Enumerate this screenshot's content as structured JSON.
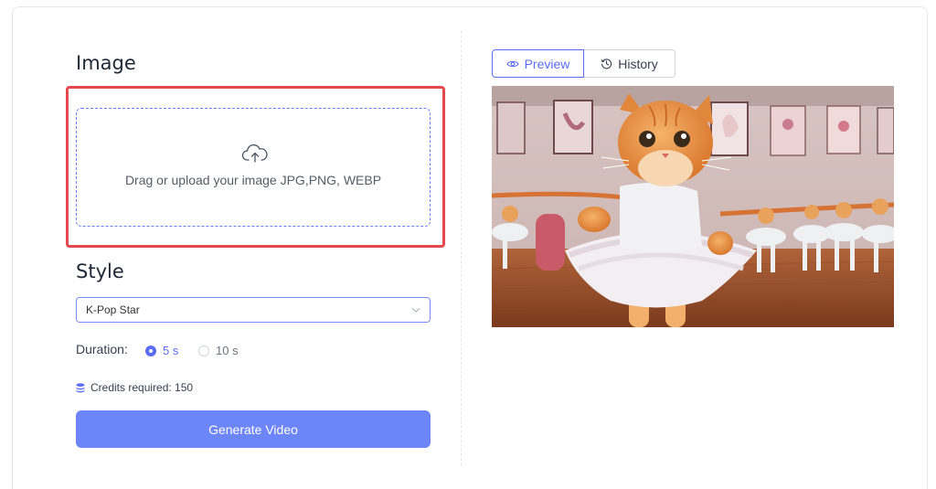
{
  "image_section": {
    "title": "Image",
    "upload_text": "Drag or upload your image JPG,PNG, WEBP"
  },
  "style_section": {
    "title": "Style",
    "selected_style": "K-Pop Star"
  },
  "duration": {
    "label": "Duration:",
    "options": [
      "5 s",
      "10 s"
    ],
    "selected": "5 s"
  },
  "credits": {
    "text": "Credits required: 150"
  },
  "generate_button": {
    "label": "Generate Video"
  },
  "tabs": {
    "preview": "Preview",
    "history": "History",
    "active": "Preview"
  },
  "preview": {
    "subject": "orange cat in white ballet tutu in a dance studio"
  },
  "colors": {
    "accent": "#5b6cf6",
    "button": "#6c85f8",
    "highlight": "#e5484d"
  }
}
